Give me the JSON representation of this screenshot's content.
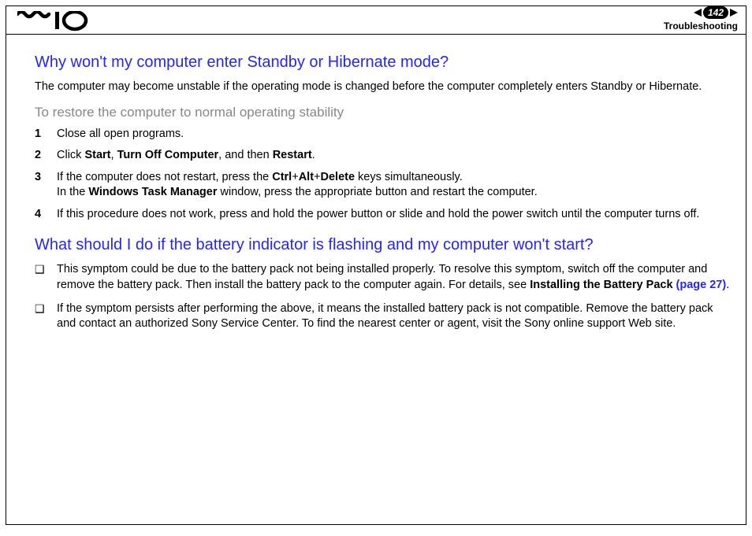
{
  "header": {
    "page_number": "142",
    "section": "Troubleshooting"
  },
  "q1": {
    "heading": "Why won't my computer enter Standby or Hibernate mode?",
    "intro": "The computer may become unstable if the operating mode is changed before the computer completely enters Standby or Hibernate.",
    "subheading": "To restore the computer to normal operating stability",
    "steps": [
      {
        "n": "1",
        "text_a": "Close all open programs."
      },
      {
        "n": "2",
        "text_a": "Click ",
        "b1": "Start",
        "sep1": ", ",
        "b2": "Turn Off Computer",
        "sep2": ", and then ",
        "b3": "Restart",
        "tail": "."
      },
      {
        "n": "3",
        "text_a": "If the computer does not restart, press the ",
        "b1": "Ctrl",
        "sep1": "+",
        "b2": "Alt",
        "sep2": "+",
        "b3": "Delete",
        "tail": " keys simultaneously.",
        "line2_a": "In the ",
        "line2_b": "Windows Task Manager",
        "line2_c": " window, press the appropriate button and restart the computer."
      },
      {
        "n": "4",
        "text_a": "If this procedure does not work, press and hold the power button or slide and hold the power switch until the computer turns off."
      }
    ]
  },
  "q2": {
    "heading": "What should I do if the battery indicator is flashing and my computer won't start?",
    "bullets": [
      {
        "a": "This symptom could be due to the battery pack not being installed properly. To resolve this symptom, switch off the computer and remove the battery pack. Then install the battery pack to the computer again. For details, see ",
        "b": "Installing the Battery Pack ",
        "link": "(page 27)",
        "tail": "."
      },
      {
        "a": "If the symptom persists after performing the above, it means the installed battery pack is not compatible. Remove the battery pack and contact an authorized Sony Service Center. To find the nearest center or agent, visit the Sony online support Web site."
      }
    ]
  }
}
